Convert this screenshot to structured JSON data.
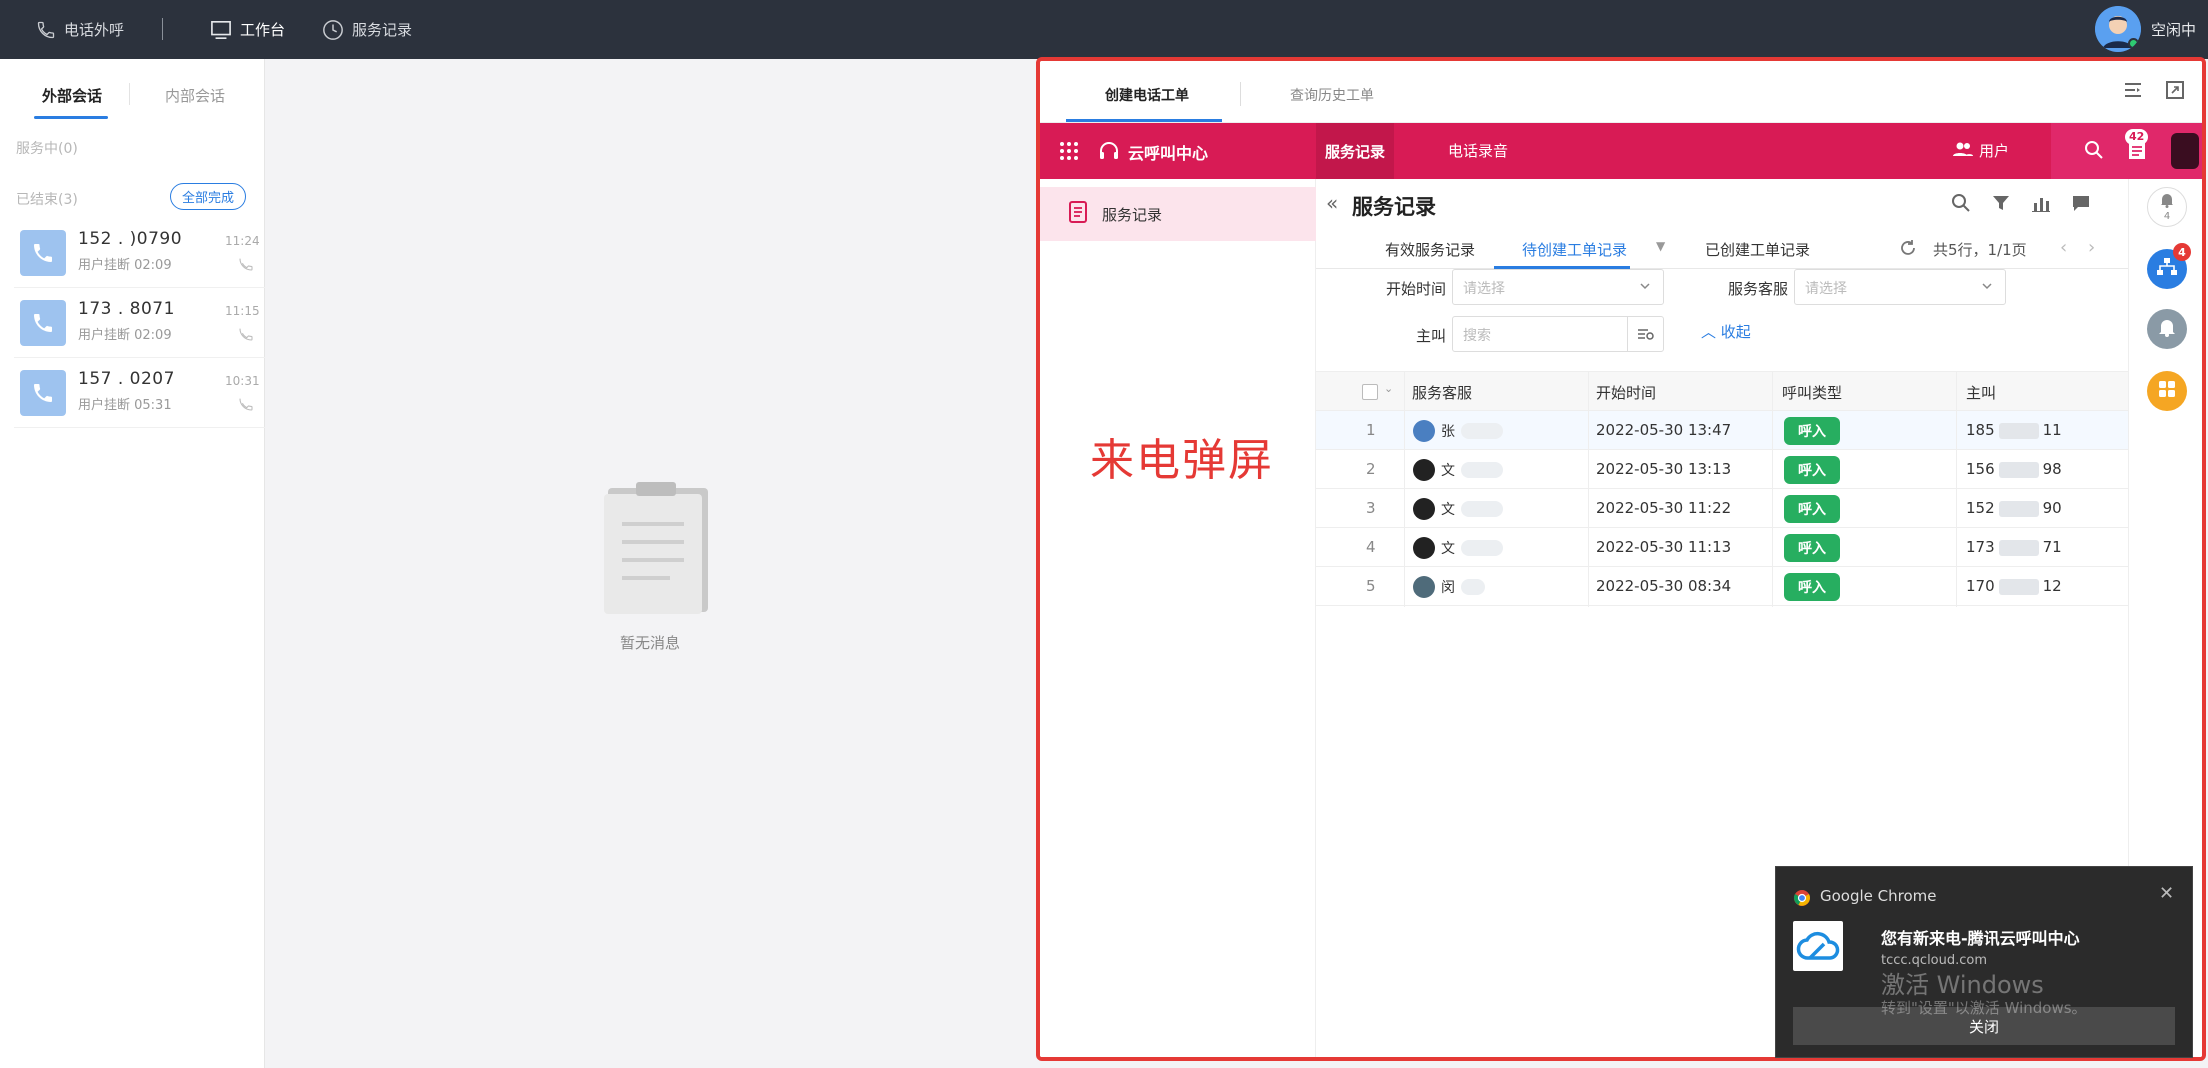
{
  "topbar": {
    "outbound_call": "电话外呼",
    "workbench": "工作台",
    "service_records": "服务记录",
    "agent_status": "空闲中"
  },
  "left": {
    "tab_external": "外部会话",
    "tab_internal": "内部会话",
    "in_service": "服务中(0)",
    "finished": "已结束(3)",
    "finish_all": "全部完成",
    "calls": [
      {
        "number": "152 .      )0790",
        "status": "用户挂断 02:09",
        "time": "11:24"
      },
      {
        "number": "173 .      8071",
        "status": "用户挂断 02:09",
        "time": "11:15"
      },
      {
        "number": "157 .      0207",
        "status": "用户挂断 05:31",
        "time": "10:31"
      }
    ],
    "empty_text": "暂无消息"
  },
  "order": {
    "tab_create": "创建电话工单",
    "tab_history": "查询历史工单"
  },
  "app": {
    "brand": "云呼叫中心",
    "nav_service_records": "服务记录",
    "nav_call_recordings": "电话录音",
    "user_link": "用户",
    "msg_count": "42",
    "side_menu_item": "服务记录",
    "popup_label": "来电弹屏",
    "page_title": "服务记录",
    "subtab_valid": "有效服务记录",
    "subtab_pending": "待创建工单记录",
    "subtab_created": "已创建工单记录",
    "pager": "共5行，1/1页",
    "filter_start_time": "开始时间",
    "filter_agent": "服务客服",
    "filter_caller": "主叫",
    "select_placeholder": "请选择",
    "search_placeholder": "搜索",
    "collapse": "收起",
    "rail_bell_count": "4",
    "rail_badge_count": "4"
  },
  "table": {
    "headers": [
      "服务客服",
      "开始时间",
      "呼叫类型",
      "主叫"
    ],
    "rows": [
      {
        "n": "1",
        "agent": "张",
        "start": "2022-05-30 13:47",
        "type": "呼入",
        "caller_a": "185",
        "caller_b": "11"
      },
      {
        "n": "2",
        "agent": "文",
        "start": "2022-05-30 13:13",
        "type": "呼入",
        "caller_a": "156",
        "caller_b": "98"
      },
      {
        "n": "3",
        "agent": "文",
        "start": "2022-05-30 11:22",
        "type": "呼入",
        "caller_a": "152",
        "caller_b": "90"
      },
      {
        "n": "4",
        "agent": "文",
        "start": "2022-05-30 11:13",
        "type": "呼入",
        "caller_a": "173",
        "caller_b": "71"
      },
      {
        "n": "5",
        "agent": "闵",
        "start": "2022-05-30 08:34",
        "type": "呼入",
        "caller_a": "170",
        "caller_b": "12"
      }
    ]
  },
  "notification": {
    "app": "Google Chrome",
    "title": "您有新来电-腾讯云呼叫中心",
    "url": "tccc.qcloud.com",
    "watermark": "激活 Windows",
    "watermark_sub": "转到\"设置\"以激活 Windows。",
    "close_button": "关闭"
  },
  "colors": {
    "accent": "#2a7de1",
    "brand_pink": "#d81b55",
    "frame_red": "#e53935",
    "call_in_green": "#27ae60"
  }
}
